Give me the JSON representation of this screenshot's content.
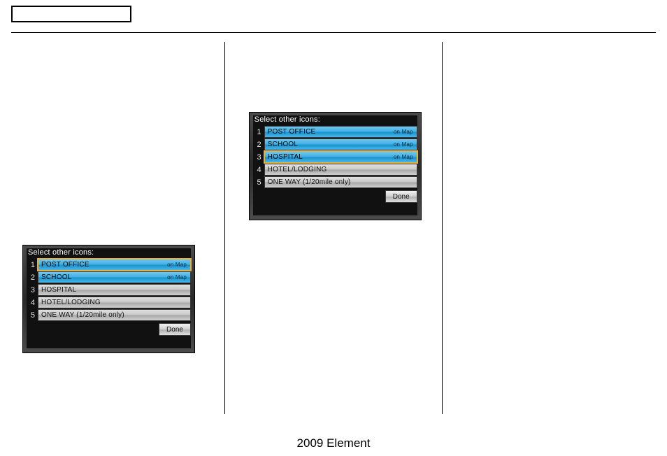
{
  "footer": "2009  Element",
  "panelA": {
    "title": "Select other icons:",
    "done": "Done",
    "items": [
      {
        "num": "1",
        "label": "POST OFFICE",
        "tag": "on Map",
        "selected": true,
        "highlight": true
      },
      {
        "num": "2",
        "label": "SCHOOL",
        "tag": "on Map",
        "selected": true,
        "highlight": false
      },
      {
        "num": "3",
        "label": "HOSPITAL",
        "tag": "",
        "selected": false,
        "highlight": false
      },
      {
        "num": "4",
        "label": "HOTEL/LODGING",
        "tag": "",
        "selected": false,
        "highlight": false
      },
      {
        "num": "5",
        "label": "ONE WAY (1/20mile only)",
        "tag": "",
        "selected": false,
        "highlight": false
      }
    ]
  },
  "panelB": {
    "title": "Select other icons:",
    "done": "Done",
    "items": [
      {
        "num": "1",
        "label": "POST OFFICE",
        "tag": "on Map",
        "selected": true,
        "highlight": false
      },
      {
        "num": "2",
        "label": "SCHOOL",
        "tag": "on Map",
        "selected": true,
        "highlight": false
      },
      {
        "num": "3",
        "label": "HOSPITAL",
        "tag": "on Map",
        "selected": true,
        "highlight": true
      },
      {
        "num": "4",
        "label": "HOTEL/LODGING",
        "tag": "",
        "selected": false,
        "highlight": false
      },
      {
        "num": "5",
        "label": "ONE WAY (1/20mile only)",
        "tag": "",
        "selected": false,
        "highlight": false
      }
    ]
  }
}
